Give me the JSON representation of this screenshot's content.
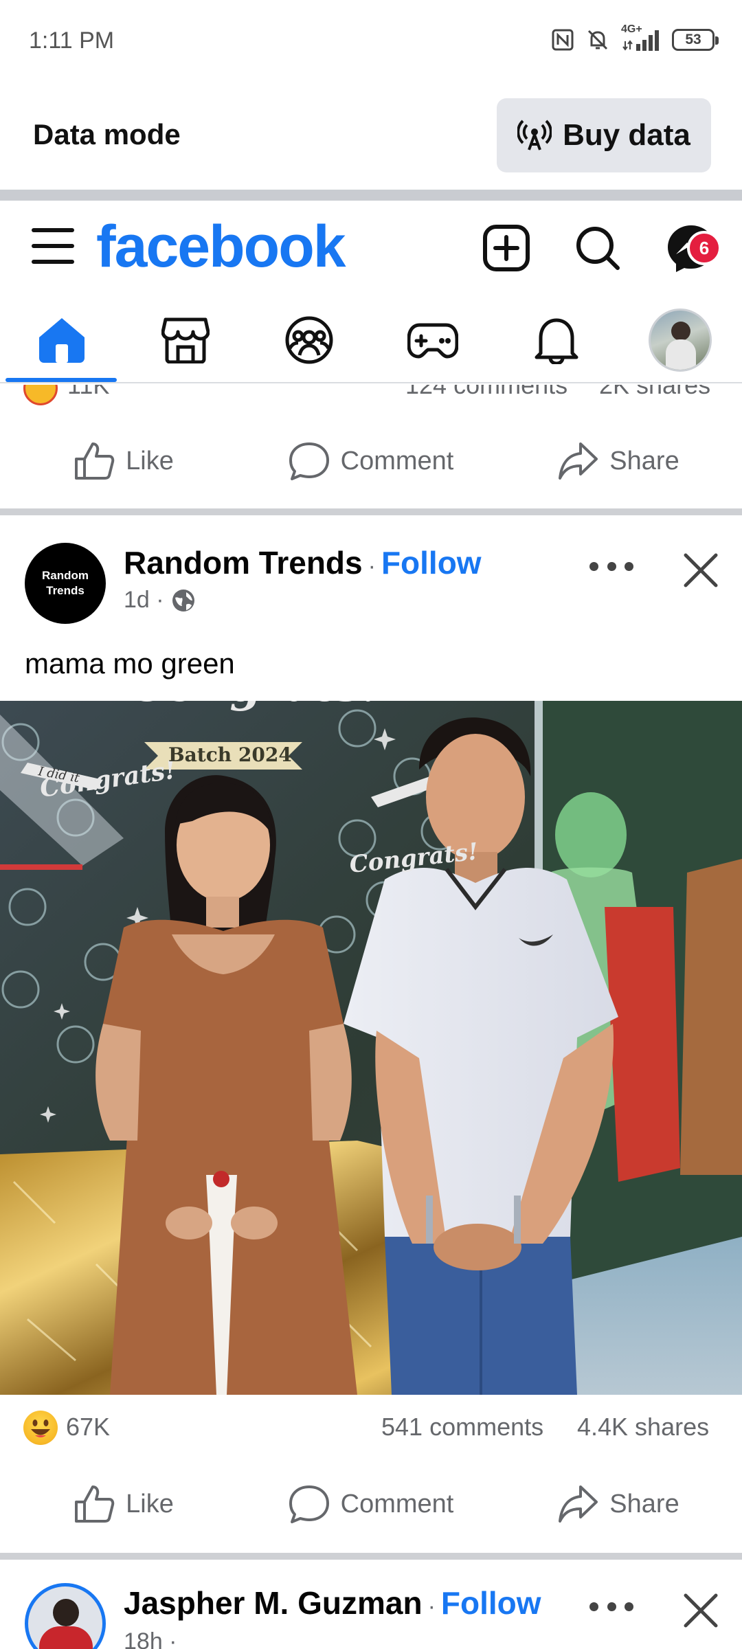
{
  "status_bar": {
    "time": "1:11 PM",
    "network": "4G+",
    "battery": "53"
  },
  "data_banner": {
    "label": "Data mode",
    "button": "Buy data"
  },
  "header": {
    "logo": "facebook",
    "messenger_badge": "6"
  },
  "tabs": [
    "home",
    "marketplace",
    "groups",
    "gaming",
    "notifications",
    "profile"
  ],
  "previous_post": {
    "reactions": "11K",
    "comments": "124 comments",
    "shares": "2K shares"
  },
  "actions": {
    "like": "Like",
    "comment": "Comment",
    "share": "Share"
  },
  "post": {
    "author": "Random Trends",
    "avatar_text_1": "Random",
    "avatar_text_2": "Trends",
    "separator": "·",
    "follow": "Follow",
    "time": "1d ·",
    "caption": "mama mo green",
    "image_text": {
      "banner": "Batch 2024",
      "congrats": "Congrats!",
      "did_it": "I did it"
    },
    "reactions": "67K",
    "comments": "541 comments",
    "shares": "4.4K shares"
  },
  "next_post": {
    "author": "Jaspher M. Guzman",
    "separator": "·",
    "follow": "Follow",
    "time": "18h ·"
  },
  "colors": {
    "brand": "#1877f2",
    "badge": "#e41e3f",
    "secondary_text": "#65676b"
  }
}
